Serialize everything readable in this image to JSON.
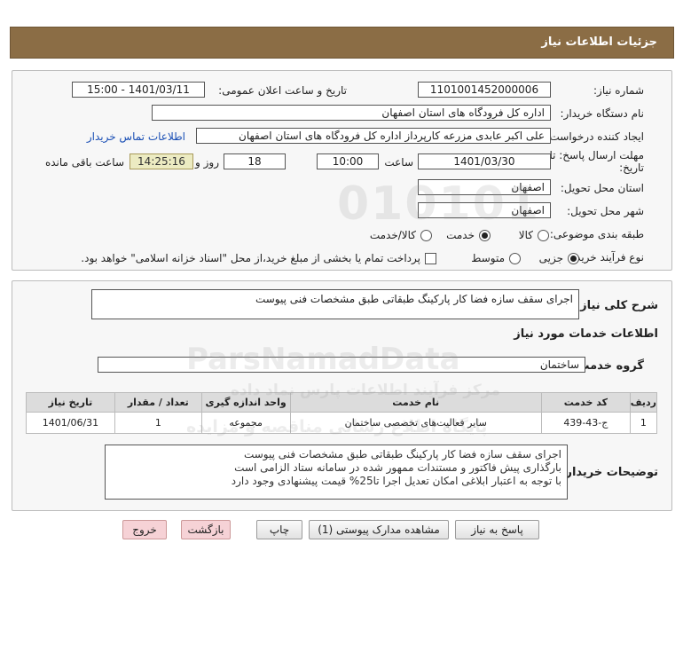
{
  "header": {
    "title": "جزئیات اطلاعات نیاز"
  },
  "form": {
    "need_number_label": "شماره نیاز:",
    "need_number": "1101001452000006",
    "announce_label": "تاریخ و ساعت اعلان عمومی:",
    "announce_value": "1401/03/11 - 15:00",
    "buyer_label": "نام دستگاه خریدار:",
    "buyer_value": "اداره کل فرودگاه های استان اصفهان",
    "creator_label": "ایجاد کننده درخواست:",
    "creator_value": "علی اکبر عابدی مزرعه کارپرداز اداره کل فرودگاه های استان اصفهان",
    "contact_link": "اطلاعات تماس خریدار",
    "deadline_label_1": "مهلت ارسال پاسخ: تا",
    "deadline_label_2": "تاریخ:",
    "deadline_date": "1401/03/30",
    "time_label": "ساعت",
    "deadline_time": "10:00",
    "days_value": "18",
    "days_label": "روز و",
    "remaining_time": "14:25:16",
    "remaining_label": "ساعت باقی مانده",
    "province_label": "استان محل تحویل:",
    "province_value": "اصفهان",
    "city_label": "شهر محل تحویل:",
    "city_value": "اصفهان",
    "category_label": "طبقه بندی موضوعی:",
    "category_options": [
      "کالا",
      "خدمت",
      "کالا/خدمت"
    ],
    "category_selected": "خدمت",
    "process_label": "نوع فرآیند خرید :",
    "process_options": [
      "جزیی",
      "متوسط"
    ],
    "process_selected": "جزیی",
    "payment_note": "پرداخت تمام یا بخشی از مبلغ خرید،از محل \"اسناد خزانه اسلامی\" خواهد بود."
  },
  "details": {
    "summary_label": "شرح کلی نیاز:",
    "summary_value": "اجرای سقف سازه فضا کار پارکینگ طبقاتی طبق مشخصات فنی پیوست",
    "services_heading": "اطلاعات خدمات مورد نیاز",
    "service_group_label": "گروه خدمت:",
    "service_group_value": "ساختمان",
    "table": {
      "headers": [
        "ردیف",
        "کد خدمت",
        "نام خدمت",
        "واحد اندازه گیری",
        "تعداد / مقدار",
        "تاریخ نیاز"
      ],
      "rows": [
        [
          "1",
          "ج-43-439",
          "سایر فعالیت‌های تخصصی ساختمان",
          "مجموعه",
          "1",
          "1401/06/31"
        ]
      ]
    },
    "buyer_notes_label": "توضیحات خریدار:",
    "buyer_notes_lines": [
      "اجرای سقف سازه فضا کار پارکینگ طبقاتی طبق مشخصات فنی پیوست",
      "بارگذاری پیش فاکتور و مستندات ممهور شده در سامانه ستاد الزامی است",
      "با توجه به اعتبار ابلاغی امکان تعدیل اجرا تا25% قیمت پیشنهادی وجود دارد"
    ]
  },
  "buttons": {
    "reply": "پاسخ به نیاز",
    "attachments": "مشاهده مدارک پیوستی (1)",
    "print": "چاپ",
    "back": "بازگشت",
    "exit": "خروج"
  },
  "watermark": {
    "line1": "ParsNamadData",
    "line2": "مرکز فرآیند اطلاعات پارس نماد داده",
    "line3": "پایگاه اطلاع رسانی مناقصه و مزایده"
  }
}
